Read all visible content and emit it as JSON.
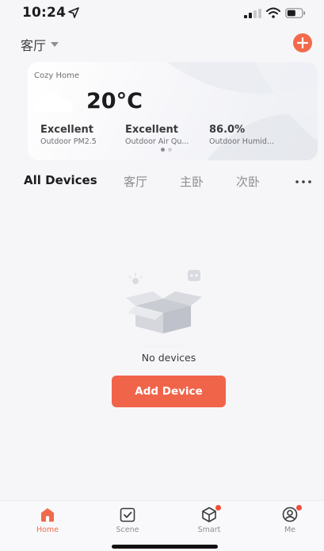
{
  "status_bar": {
    "time": "10:24",
    "icons": [
      "location-arrow-icon",
      "signal-icon",
      "wifi-icon",
      "battery-icon"
    ]
  },
  "header": {
    "room": "客厅",
    "add_icon": "plus-circle-icon"
  },
  "weather": {
    "home_name": "Cozy Home",
    "icon": "cloud-icon",
    "temperature": "20°C",
    "metrics": [
      {
        "value": "Excellent",
        "label": "Outdoor PM2.5"
      },
      {
        "value": "Excellent",
        "label": "Outdoor Air Qu..."
      },
      {
        "value": "86.0%",
        "label": "Outdoor Humid..."
      }
    ],
    "pages": 2,
    "current_page": 1
  },
  "tabs": [
    {
      "label": "All Devices",
      "active": true
    },
    {
      "label": "客厅",
      "active": false
    },
    {
      "label": "主卧",
      "active": false
    },
    {
      "label": "次卧",
      "active": false
    }
  ],
  "empty_state": {
    "message": "No devices",
    "button_label": "Add Device"
  },
  "nav": [
    {
      "label": "Home",
      "icon": "home-icon",
      "active": true,
      "badge": false
    },
    {
      "label": "Scene",
      "icon": "scene-check-icon",
      "active": false,
      "badge": false
    },
    {
      "label": "Smart",
      "icon": "smart-cube-icon",
      "active": false,
      "badge": true
    },
    {
      "label": "Me",
      "icon": "profile-icon",
      "active": false,
      "badge": true
    }
  ],
  "colors": {
    "accent": "#f26a4b",
    "badge": "#f04d3a",
    "text_primary": "#1c1c1e",
    "text_secondary": "#8e8e93"
  }
}
